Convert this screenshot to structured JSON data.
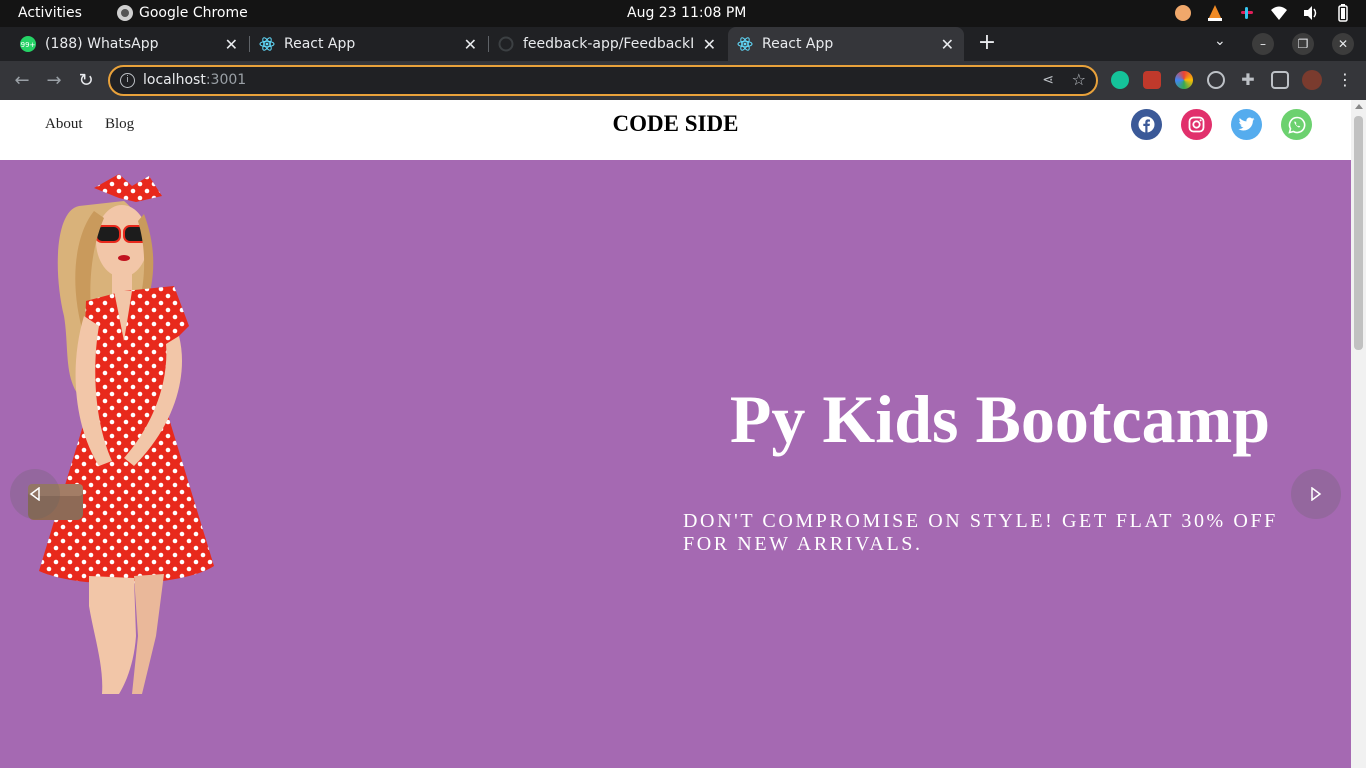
{
  "os": {
    "activities": "Activities",
    "app_name": "Google Chrome",
    "clock": "Aug 23  11:08 PM"
  },
  "tabs": [
    {
      "title": "(188) WhatsApp",
      "favicon": "whatsapp-icon"
    },
    {
      "title": "React App",
      "favicon": "react-icon"
    },
    {
      "title": "feedback-app/FeedbackL",
      "favicon": "github-icon"
    },
    {
      "title": "React App",
      "favicon": "react-icon",
      "active": true
    }
  ],
  "toolbar": {
    "url_host": "localhost",
    "url_port": ":3001"
  },
  "site": {
    "nav_links": [
      "About",
      "Blog"
    ],
    "brand": "CODE SIDE",
    "social": [
      {
        "name": "facebook",
        "color": "#3b5998"
      },
      {
        "name": "instagram",
        "color": "#e1306c"
      },
      {
        "name": "twitter",
        "color": "#55acee"
      },
      {
        "name": "whatsapp",
        "color": "#6cd16f"
      }
    ]
  },
  "hero": {
    "title": "Py Kids Bootcamp",
    "subtitle": "DON'T COMPROMISE ON STYLE! GET FLAT 30% OFF FOR NEW ARRIVALS.",
    "background": "#a569b2"
  }
}
